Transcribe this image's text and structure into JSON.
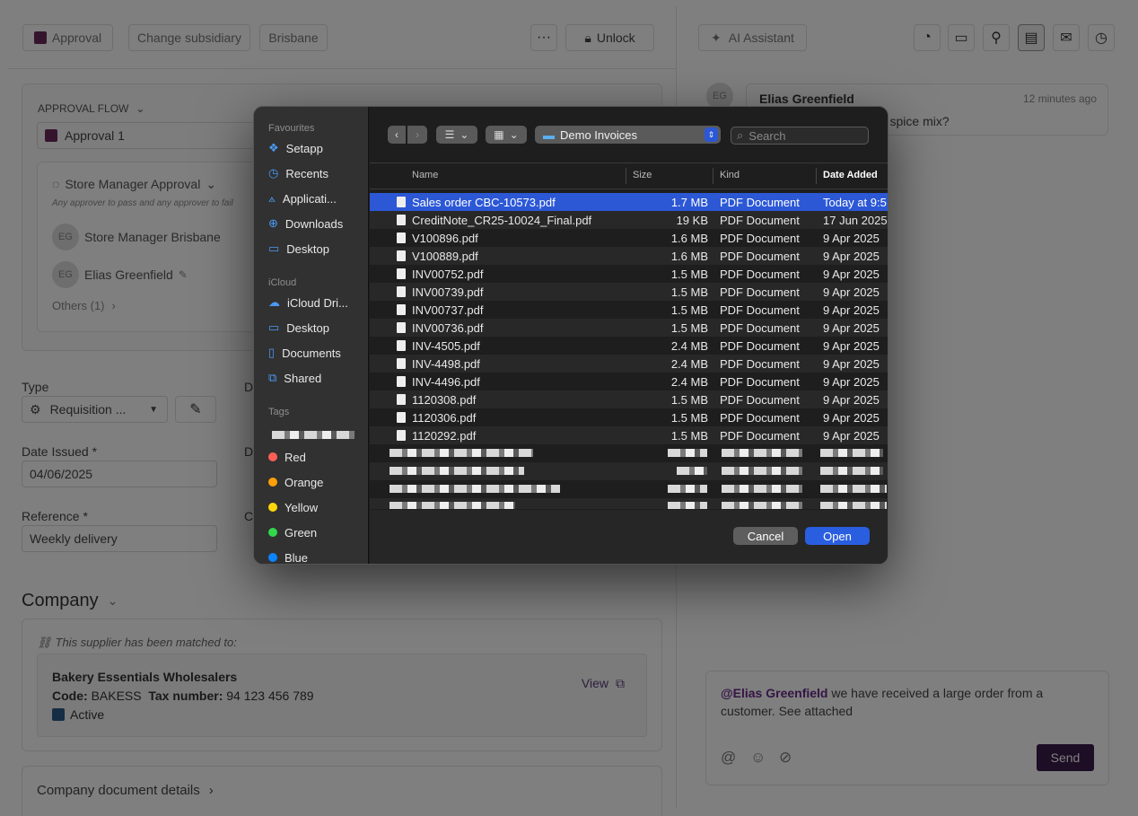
{
  "toolbar": {
    "approval": "Approval",
    "change_subsidiary": "Change subsidiary",
    "brisbane": "Brisbane",
    "more": "···",
    "unlock": "Unlock"
  },
  "approval_flow": {
    "header": "APPROVAL FLOW",
    "step": "Approval 1",
    "group_title": "Store Manager Approval",
    "rule": "Any approver to pass and any approver to fail",
    "approvers": [
      {
        "initials": "EG",
        "name": "Store Manager Brisbane"
      },
      {
        "initials": "EG",
        "name": "Elias Greenfield"
      }
    ],
    "others": "Others (1)"
  },
  "form": {
    "type_label": "Type",
    "type_value": "Requisition ...",
    "date_label": "Date Issued *",
    "date_value": "04/06/2025",
    "ref_label": "Reference *",
    "ref_value": "Weekly delivery",
    "d1": "D",
    "d2": "D",
    "c1": "C"
  },
  "company": {
    "title": "Company",
    "matched": "This supplier has been matched to:",
    "name": "Bakery Essentials Wholesalers",
    "code_label": "Code:",
    "code": "BAKESS",
    "tax_label": "Tax number:",
    "tax": "94 123 456 789",
    "status": "Active",
    "view": "View",
    "details": "Company document details"
  },
  "right": {
    "ai": "AI Assistant",
    "comment": {
      "initials": "EG",
      "author": "Elias Greenfield",
      "time": "12 minutes ago",
      "text": "e we ordering so much spice mix?"
    },
    "compose": {
      "mention": "@Elias Greenfield",
      "text": " we have received a large order from a customer. See attached"
    },
    "send": "Send"
  },
  "dialog": {
    "sidebar": {
      "favourites_header": "Favourites",
      "favourites": [
        {
          "icon": "setapp-icon",
          "label": "Setapp"
        },
        {
          "icon": "clock-icon",
          "label": "Recents"
        },
        {
          "icon": "applications-icon",
          "label": "Applicati..."
        },
        {
          "icon": "download-icon",
          "label": "Downloads"
        },
        {
          "icon": "desktop-icon",
          "label": "Desktop"
        }
      ],
      "icloud_header": "iCloud",
      "icloud": [
        {
          "icon": "cloud-icon",
          "label": "iCloud Dri..."
        },
        {
          "icon": "desktop-icon",
          "label": "Desktop"
        },
        {
          "icon": "document-icon",
          "label": "Documents"
        },
        {
          "icon": "shared-folder-icon",
          "label": "Shared"
        }
      ],
      "tags_header": "Tags",
      "tags": [
        {
          "label": "Red",
          "color": "#ff5f57"
        },
        {
          "label": "Orange",
          "color": "#ff9f0a"
        },
        {
          "label": "Yellow",
          "color": "#ffd60a"
        },
        {
          "label": "Green",
          "color": "#32d74b"
        },
        {
          "label": "Blue",
          "color": "#0a84ff"
        }
      ]
    },
    "location": "Demo Invoices",
    "search_placeholder": "Search",
    "columns": {
      "name": "Name",
      "size": "Size",
      "kind": "Kind",
      "date": "Date Added"
    },
    "files": [
      {
        "name": "Sales order CBC-10573.pdf",
        "size": "1.7 MB",
        "kind": "PDF Document",
        "date": "Today at 9:5"
      },
      {
        "name": "CreditNote_CR25-10024_Final.pdf",
        "size": "19 KB",
        "kind": "PDF Document",
        "date": "17 Jun 2025"
      },
      {
        "name": "V100896.pdf",
        "size": "1.6 MB",
        "kind": "PDF Document",
        "date": "9 Apr 2025"
      },
      {
        "name": "V100889.pdf",
        "size": "1.6 MB",
        "kind": "PDF Document",
        "date": "9 Apr 2025"
      },
      {
        "name": "INV00752.pdf",
        "size": "1.5 MB",
        "kind": "PDF Document",
        "date": "9 Apr 2025"
      },
      {
        "name": "INV00739.pdf",
        "size": "1.5 MB",
        "kind": "PDF Document",
        "date": "9 Apr 2025"
      },
      {
        "name": "INV00737.pdf",
        "size": "1.5 MB",
        "kind": "PDF Document",
        "date": "9 Apr 2025"
      },
      {
        "name": "INV00736.pdf",
        "size": "1.5 MB",
        "kind": "PDF Document",
        "date": "9 Apr 2025"
      },
      {
        "name": "INV-4505.pdf",
        "size": "2.4 MB",
        "kind": "PDF Document",
        "date": "9 Apr 2025"
      },
      {
        "name": "INV-4498.pdf",
        "size": "2.4 MB",
        "kind": "PDF Document",
        "date": "9 Apr 2025"
      },
      {
        "name": "INV-4496.pdf",
        "size": "2.4 MB",
        "kind": "PDF Document",
        "date": "9 Apr 2025"
      },
      {
        "name": "1120308.pdf",
        "size": "1.5 MB",
        "kind": "PDF Document",
        "date": "9 Apr 2025"
      },
      {
        "name": "1120306.pdf",
        "size": "1.5 MB",
        "kind": "PDF Document",
        "date": "9 Apr 2025"
      },
      {
        "name": "1120292.pdf",
        "size": "1.5 MB",
        "kind": "PDF Document",
        "date": "9 Apr 2025"
      }
    ],
    "cancel": "Cancel",
    "open": "Open"
  },
  "colors": {
    "accent_purple": "#3a1a4a",
    "selection": "#2c58d6",
    "open_button": "#2a5ee0"
  }
}
